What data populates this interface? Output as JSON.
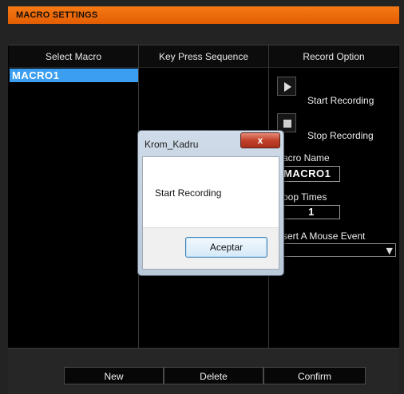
{
  "window": {
    "title": "MACRO SETTINGS"
  },
  "columns": {
    "select_macro": "Select Macro",
    "key_press_sequence": "Key Press Sequence",
    "record_option": "Record Option"
  },
  "macros": [
    {
      "label": "MACRO1",
      "selected": true
    }
  ],
  "record_option": {
    "start_label": "Start Recording",
    "stop_label": "Stop Recording",
    "macro_name_label": "acro Name",
    "macro_name_value": "MACRO1",
    "loop_times_label": "oop Times",
    "loop_times_value": "1",
    "mouse_event_label": "sert A Mouse Event",
    "mouse_event_value": ""
  },
  "buttons": {
    "new": "New",
    "delete": "Delete",
    "confirm": "Confirm"
  },
  "dialog": {
    "title": "Krom_Kadru",
    "close": "x",
    "message": "Start Recording",
    "ok": "Aceptar"
  },
  "colors": {
    "accent": "#e96b08",
    "selection": "#3c9ef0",
    "background": "#000000",
    "close_button": "#c2402a"
  },
  "icons": [
    "play-icon",
    "stop-icon",
    "chevron-down-icon"
  ]
}
